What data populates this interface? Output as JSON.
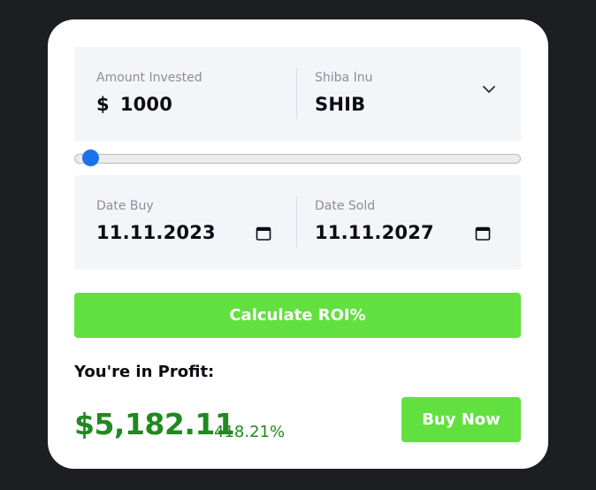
{
  "investment": {
    "amount_label": "Amount Invested",
    "currency_symbol": "$",
    "amount_value": "1000",
    "coin_label": "Shiba Inu",
    "coin_value": "SHIB",
    "dropdown_icon": "chevron-down-icon"
  },
  "slider": {
    "level": 0.01,
    "accent_color": "#1a73e8"
  },
  "dates": {
    "buy_label": "Date Buy",
    "buy_value": "11.11.2023",
    "sold_label": "Date Sold",
    "sold_value": "11.11.2027",
    "icon": "calendar-icon"
  },
  "actions": {
    "calculate_label": "Calculate ROI%",
    "buy_label": "Buy Now"
  },
  "result": {
    "heading": "You're in Profit:",
    "amount": "$5,182.11",
    "percent": "418.21%"
  },
  "colors": {
    "button": "#62e03f",
    "profit": "#1f8a1f",
    "background": "#1c1e22"
  }
}
